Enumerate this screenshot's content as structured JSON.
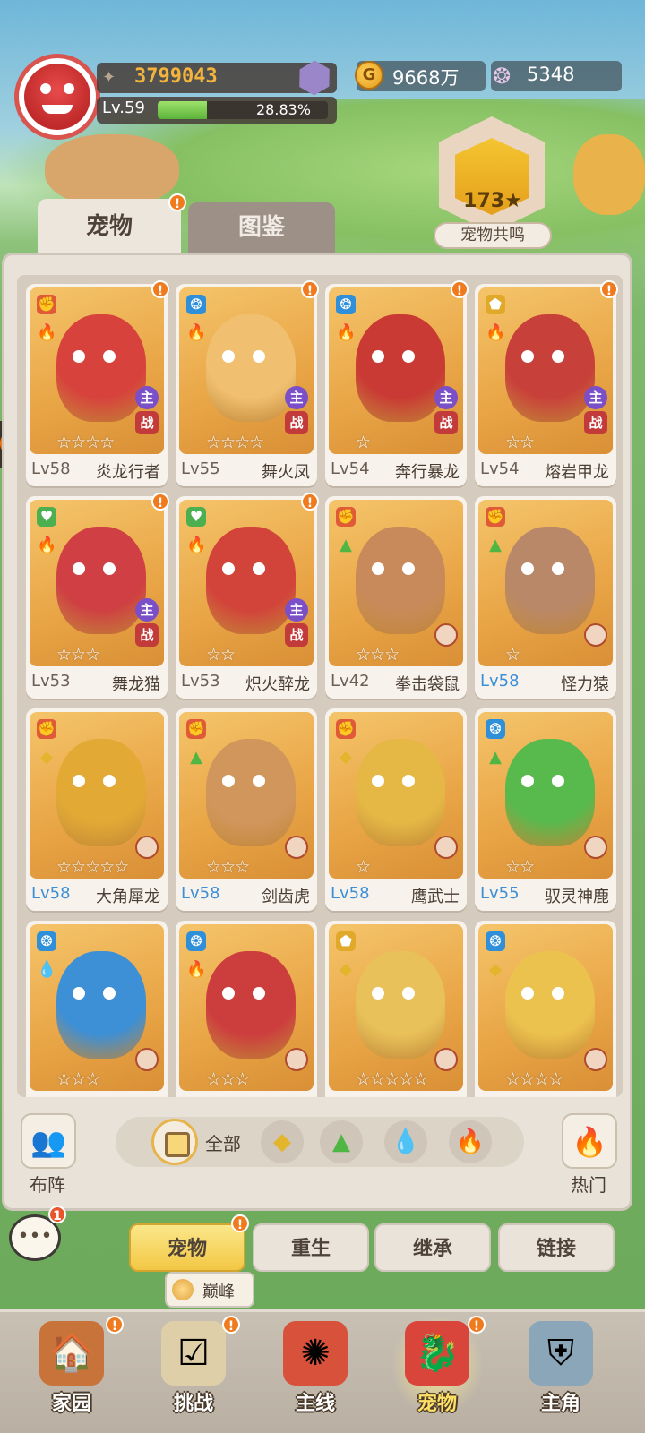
{
  "header": {
    "power_value": "3799043",
    "level": "Lv.59",
    "exp_percent_text": "28.83%",
    "exp_fraction": 0.2883,
    "gold": "9668万",
    "shells": "5348"
  },
  "resonance": {
    "count": "173★",
    "label": "宠物共鸣"
  },
  "tabs": {
    "pets": "宠物",
    "guide": "图鉴"
  },
  "pets": [
    {
      "level": "Lv58",
      "name": "炎龙行者",
      "stars": 4,
      "filled": 0,
      "trait": "red",
      "element": "fire",
      "main": "主",
      "battle": "战",
      "alert": true,
      "color": "#d7423c",
      "max": false
    },
    {
      "level": "Lv55",
      "name": "舞火凤",
      "stars": 4,
      "filled": 0,
      "trait": "blue",
      "element": "fire",
      "main": "主",
      "battle": "战",
      "alert": true,
      "color": "#f0c070",
      "max": false
    },
    {
      "level": "Lv54",
      "name": "奔行暴龙",
      "stars": 1,
      "filled": 0,
      "trait": "blue",
      "element": "fire",
      "main": "主",
      "battle": "战",
      "alert": true,
      "color": "#c93a34",
      "max": false
    },
    {
      "level": "Lv54",
      "name": "熔岩甲龙",
      "stars": 2,
      "filled": 0,
      "trait": "yellow",
      "element": "fire",
      "main": "主",
      "battle": "战",
      "alert": true,
      "color": "#c8403a",
      "max": false
    },
    {
      "level": "Lv53",
      "name": "舞龙猫",
      "stars": 3,
      "filled": 0,
      "trait": "green",
      "element": "fire",
      "main": "主",
      "battle": "战",
      "alert": true,
      "color": "#cf3f43",
      "max": false
    },
    {
      "level": "Lv53",
      "name": "炽火醉龙",
      "stars": 2,
      "filled": 0,
      "trait": "green",
      "element": "fire",
      "main": "主",
      "battle": "战",
      "alert": true,
      "color": "#d2433a",
      "max": false
    },
    {
      "level": "Lv42",
      "name": "拳击袋鼠",
      "stars": 3,
      "filled": 0,
      "trait": "red",
      "element": "grass",
      "main": "",
      "battle": "",
      "alert": false,
      "color": "#c88a5a",
      "max": false
    },
    {
      "level": "Lv58",
      "name": "怪力猿",
      "stars": 1,
      "filled": 0,
      "trait": "red",
      "element": "grass",
      "main": "",
      "battle": "",
      "alert": false,
      "color": "#b98868",
      "max": true
    },
    {
      "level": "Lv58",
      "name": "大角犀龙",
      "stars": 5,
      "filled": 0,
      "trait": "red",
      "element": "earth",
      "main": "",
      "battle": "",
      "alert": false,
      "color": "#e2a935",
      "max": true
    },
    {
      "level": "Lv58",
      "name": "剑齿虎",
      "stars": 3,
      "filled": 0,
      "trait": "red",
      "element": "grass",
      "main": "",
      "battle": "",
      "alert": false,
      "color": "#d1965c",
      "max": true
    },
    {
      "level": "Lv58",
      "name": "鹰武士",
      "stars": 1,
      "filled": 0,
      "trait": "red",
      "element": "earth",
      "main": "",
      "battle": "",
      "alert": false,
      "color": "#e5b845",
      "max": true
    },
    {
      "level": "Lv55",
      "name": "驭灵神鹿",
      "stars": 2,
      "filled": 0,
      "trait": "blue",
      "element": "grass",
      "main": "",
      "battle": "",
      "alert": false,
      "color": "#58b94d",
      "max": true
    },
    {
      "level": "",
      "name": "",
      "stars": 3,
      "filled": 0,
      "trait": "blue",
      "element": "water",
      "main": "",
      "battle": "",
      "alert": false,
      "color": "#3d8fd6",
      "max": false
    },
    {
      "level": "",
      "name": "",
      "stars": 3,
      "filled": 0,
      "trait": "blue",
      "element": "fire",
      "main": "",
      "battle": "",
      "alert": false,
      "color": "#cc3d3d",
      "max": false
    },
    {
      "level": "",
      "name": "",
      "stars": 5,
      "filled": 0,
      "trait": "yellow",
      "element": "earth",
      "main": "",
      "battle": "",
      "alert": false,
      "color": "#e8c15a",
      "max": false
    },
    {
      "level": "",
      "name": "",
      "stars": 4,
      "filled": 0,
      "trait": "blue",
      "element": "earth",
      "main": "",
      "battle": "",
      "alert": false,
      "color": "#ecc24e",
      "max": false
    }
  ],
  "filters": {
    "all_label": "全部",
    "formation_label": "布阵",
    "hot_label": "热门",
    "chips": [
      "earth-icon",
      "grass-icon",
      "water-icon",
      "fire-icon"
    ]
  },
  "chat": {
    "badge": "1"
  },
  "sub_tabs": [
    "宠物",
    "重生",
    "继承",
    "链接"
  ],
  "peak": {
    "label": "巅峰"
  },
  "nav": [
    {
      "label": "家园",
      "icon": "home-icon"
    },
    {
      "label": "挑战",
      "icon": "challenge-icon"
    },
    {
      "label": "主线",
      "icon": "mainline-icon"
    },
    {
      "label": "宠物",
      "icon": "pet-icon"
    },
    {
      "label": "主角",
      "icon": "hero-icon"
    }
  ],
  "colors": {
    "accent_gold": "#f3b43d",
    "alert_orange": "#f07a1e",
    "main_badge": "#7b4fc7",
    "battle_badge": "#c23a3a",
    "max_level_blue": "#3b8fd8"
  }
}
